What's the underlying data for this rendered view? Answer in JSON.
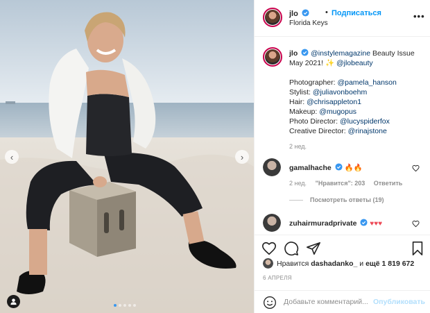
{
  "header": {
    "username": "jlo",
    "separator": "•",
    "follow_label": "Подписаться",
    "location": "Florida Keys",
    "more_label": "•••"
  },
  "caption": {
    "username": "jlo",
    "line1_mention": "@instylemagazine",
    "line1_text": " Beauty Issue",
    "line2_text": "May 2021! ",
    "line2_emoji": "✨",
    "line2_mention": "@jlobeauty",
    "credits": [
      {
        "label": "Photographer: ",
        "mention": "@pamela_hanson"
      },
      {
        "label": "Stylist: ",
        "mention": "@juliavonboehm"
      },
      {
        "label": "Hair: ",
        "mention": "@chrisappleton1"
      },
      {
        "label": "Makeup: ",
        "mention": "@mugopus"
      },
      {
        "label": "Photo Director: ",
        "mention": "@lucyspiderfox"
      },
      {
        "label": "Creative Director: ",
        "mention": "@rinajstone"
      }
    ],
    "time": "2 нед."
  },
  "comments": [
    {
      "username": "gamalhache",
      "emoji": "🔥🔥",
      "time": "2 нед.",
      "likes": "\"Нравится\": 203",
      "reply_label": "Ответить",
      "view_replies": "Посмотреть ответы (19)"
    },
    {
      "username": "zuhairmuradprivate",
      "emoji": "♥♥♥"
    }
  ],
  "likes": {
    "prefix": "Нравится ",
    "user": "dashadanko_",
    "middle": " и ",
    "count": "ещё 1 819 672"
  },
  "date": "6 АПРЕЛЯ",
  "add_comment": {
    "placeholder": "Добавьте комментарий...",
    "publish_label": "Опубликовать"
  },
  "carousel": {
    "slide_count": 5,
    "active_index": 0
  },
  "colors": {
    "link": "#00376b",
    "accent": "#0095f6",
    "heart": "#ed4956",
    "story_ring": "#c9004c"
  },
  "icons": [
    "verified-badge-icon",
    "heart-icon",
    "comment-icon",
    "share-icon",
    "bookmark-icon",
    "emoji-icon",
    "user-tag-icon"
  ]
}
